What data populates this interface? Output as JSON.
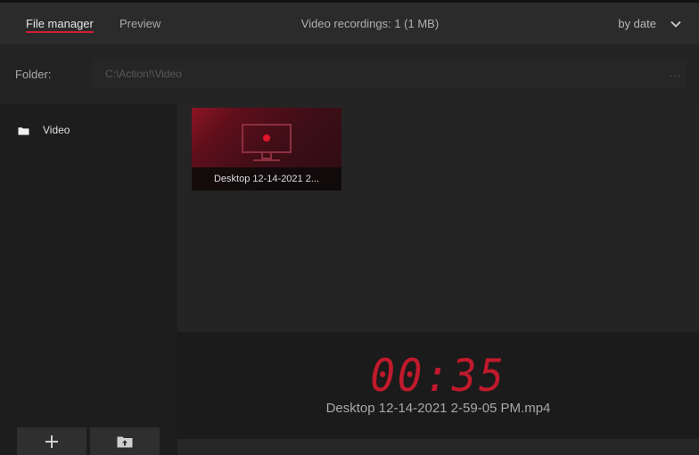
{
  "header": {
    "tabs": [
      {
        "label": "File manager",
        "active": true
      },
      {
        "label": "Preview",
        "active": false
      }
    ],
    "summary": "Video recordings: 1 (1 MB)",
    "sort": {
      "label": "by date",
      "icon": "chevron-down-icon"
    }
  },
  "folder": {
    "label": "Folder:",
    "path": "C:\\Action!\\Video",
    "browse_label": "..."
  },
  "sidebar": {
    "items": [
      {
        "label": "Video",
        "icon": "folder-icon"
      }
    ],
    "buttons": [
      {
        "icon": "plus-icon"
      },
      {
        "icon": "folder-upload-icon"
      }
    ]
  },
  "recordings": [
    {
      "caption": "Desktop 12-14-2021 2...",
      "icon": "monitor-record-icon"
    }
  ],
  "preview": {
    "timer": "00:35",
    "filename": "Desktop 12-14-2021 2-59-05 PM.mp4"
  },
  "colors": {
    "accent": "#d21d33",
    "timer": "#c01a2c",
    "background": "#1e1e1e"
  }
}
